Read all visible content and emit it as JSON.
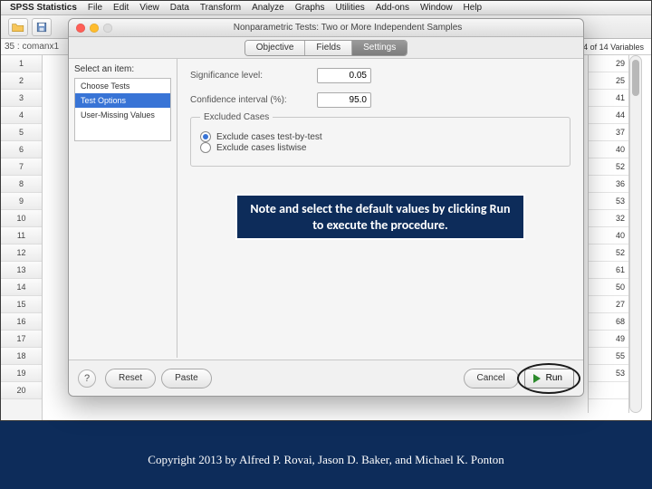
{
  "menubar": {
    "app": "SPSS Statistics",
    "items": [
      "File",
      "Edit",
      "View",
      "Data",
      "Transform",
      "Analyze",
      "Graphs",
      "Utilities",
      "Add-ons",
      "Window",
      "Help"
    ]
  },
  "status": {
    "cell_label": "35 : comanx1",
    "var_count": "14 of 14 Variables"
  },
  "rows": [
    "1",
    "2",
    "3",
    "4",
    "5",
    "6",
    "7",
    "8",
    "9",
    "10",
    "11",
    "12",
    "13",
    "14",
    "15",
    "16",
    "17",
    "18",
    "19",
    "20"
  ],
  "data_values": [
    "29",
    "25",
    "41",
    "44",
    "37",
    "40",
    "52",
    "36",
    "53",
    "32",
    "40",
    "52",
    "61",
    "50",
    "27",
    "68",
    "49",
    "55",
    "53",
    ""
  ],
  "dialog": {
    "title": "Nonparametric Tests: Two or More Independent Samples",
    "tabs": {
      "objective": "Objective",
      "fields": "Fields",
      "settings": "Settings"
    },
    "side_label": "Select an item:",
    "side_items": {
      "choose": "Choose Tests",
      "options": "Test Options",
      "missing": "User-Missing Values"
    },
    "sig_label": "Significance level:",
    "sig_value": "0.05",
    "ci_label": "Confidence interval (%):",
    "ci_value": "95.0",
    "excluded_title": "Excluded Cases",
    "radio_a": "Exclude cases test-by-test",
    "radio_b": "Exclude cases listwise",
    "help": "?",
    "reset": "Reset",
    "paste": "Paste",
    "cancel": "Cancel",
    "run": "Run"
  },
  "callout": "Note and select the default values by clicking Run to execute the procedure.",
  "copyright": "Copyright 2013 by Alfred P. Rovai, Jason D. Baker, and Michael K. Ponton"
}
